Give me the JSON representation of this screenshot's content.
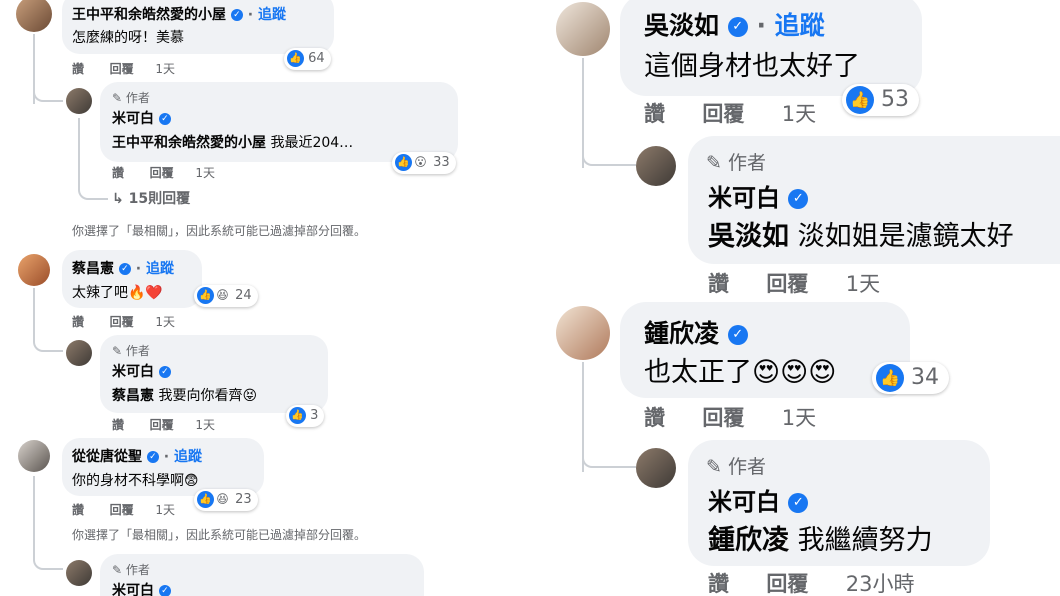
{
  "left": {
    "comments": [
      {
        "name": "王中平和余皓然愛的小屋",
        "follow": "追蹤",
        "text": "怎麼練的呀！美慕",
        "actions": [
          "讚",
          "回覆",
          "1天"
        ],
        "reactions": "64",
        "reply": {
          "author_tag": "作者",
          "name": "米可白",
          "mention": "王中平和余皓然愛的小屋",
          "text": "我最近204…",
          "actions": [
            "讚",
            "回覆",
            "1天"
          ],
          "reactions": "33"
        },
        "more_replies": "15則回覆",
        "filter_note": "你選擇了「最相關」，因此系統可能已過濾掉部分回覆。"
      },
      {
        "name": "蔡昌憲",
        "follow": "追蹤",
        "text": "太辣了吧🔥❤️",
        "actions": [
          "讚",
          "回覆",
          "1天"
        ],
        "reactions": "24",
        "reply": {
          "author_tag": "作者",
          "name": "米可白",
          "mention": "蔡昌憲",
          "text": "我要向你看齊😝",
          "actions": [
            "讚",
            "回覆",
            "1天"
          ],
          "reactions": "3"
        }
      },
      {
        "name": "從從唐從聖",
        "follow": "追蹤",
        "text": "你的身材不科學啊😨",
        "actions": [
          "讚",
          "回覆",
          "1天"
        ],
        "reactions": "23",
        "filter_note": "你選擇了「最相關」，因此系統可能已過濾掉部分回覆。",
        "reply": {
          "author_tag": "作者",
          "name": "米可白"
        }
      }
    ]
  },
  "right": {
    "comments": [
      {
        "name": "吳淡如",
        "follow": "追蹤",
        "text": "這個身材也太好了",
        "actions": [
          "讚",
          "回覆",
          "1天"
        ],
        "reactions": "53",
        "reply": {
          "author_tag": "作者",
          "name": "米可白",
          "mention": "吳淡如",
          "text": "淡如姐是濾鏡太好",
          "actions": [
            "讚",
            "回覆",
            "1天"
          ]
        }
      },
      {
        "name": "鍾欣凌",
        "text": "也太正了😍😍😍",
        "actions": [
          "讚",
          "回覆",
          "1天"
        ],
        "reactions": "34",
        "reply": {
          "author_tag": "作者",
          "name": "米可白",
          "mention": "鍾欣凌",
          "text": "我繼續努力",
          "actions": [
            "讚",
            "回覆",
            "23小時"
          ]
        }
      }
    ]
  },
  "icons": {
    "verified": "verified-check-icon",
    "like": "thumbs-up-icon",
    "pencil": "pencil-icon",
    "reply_arrow": "reply-arrow-icon"
  },
  "colors": {
    "link": "#1877f2",
    "bubble": "#f0f2f5",
    "meta": "#65676b"
  }
}
